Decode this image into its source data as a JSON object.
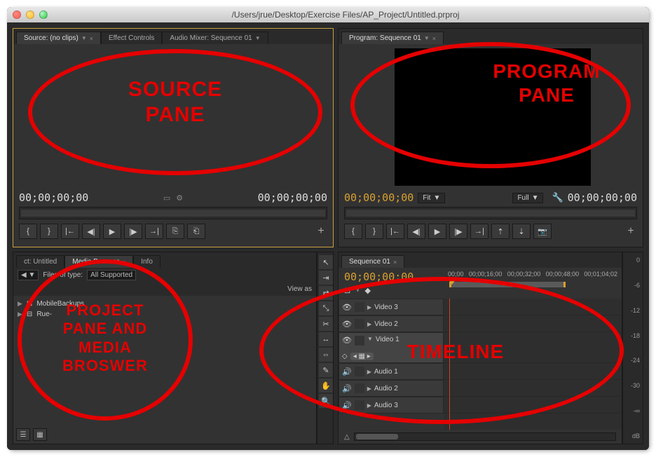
{
  "window": {
    "title": "/Users/jrue/Desktop/Exercise Files/AP_Project/Untitled.prproj"
  },
  "source": {
    "tab_label": "Source: (no clips)",
    "tab_effect": "Effect Controls",
    "tab_audio": "Audio Mixer: Sequence 01",
    "tc_left": "00;00;00;00",
    "tc_right": "00;00;00;00"
  },
  "program": {
    "tab_label": "Program: Sequence 01",
    "tc_left": "00;00;00;00",
    "tc_right": "00;00;00;00",
    "fit_label": "Fit",
    "full_label": "Full"
  },
  "project": {
    "tab_project": "ct: Untitled",
    "tab_media": "Media Browser",
    "tab_info": "Info",
    "files_of_type_label": "Files of type:",
    "files_of_type_value": "All Supported",
    "view_as": "View as",
    "items": [
      "MobileBackups",
      "Rue-"
    ]
  },
  "timeline": {
    "tab_label": "Sequence 01",
    "tc": "00;00;00;00",
    "ruler": [
      "00;00",
      "00;00;16;00",
      "00;00;32;00",
      "00;00;48;00",
      "00;01;04;02"
    ],
    "tracks": {
      "v3": "Video 3",
      "v2": "Video 2",
      "v1": "Video 1",
      "a1": "Audio 1",
      "a2": "Audio 2",
      "a3": "Audio 3"
    }
  },
  "meter": {
    "unit": "dB",
    "ticks": [
      "0",
      "-6",
      "-12",
      "-18",
      "-24",
      "-30",
      "-∞"
    ]
  },
  "annotations": {
    "source": "SOURCE PANE",
    "program": "PROGRAM PANE",
    "project": "PROJECT PANE AND MEDIA BROSWER",
    "timeline": "TIMELINE"
  },
  "icons": {
    "dropdown": "▼",
    "close": "×",
    "plus": "+",
    "wrench": "🔧",
    "mark_in": "{",
    "mark_out": "}",
    "goto_in": "|←",
    "step_back": "◀|",
    "play": "▶",
    "step_fwd": "|▶",
    "goto_out": "→|",
    "insert": "⎘",
    "overwrite": "⎗",
    "lift": "⇡",
    "extract": "⇣",
    "export": "📷",
    "arrow": "↖",
    "track_select": "⇥",
    "ripple": "⇄",
    "razor": "✂",
    "slip": "↔",
    "pen": "✎",
    "hand": "✋",
    "zoom": "🔍",
    "eye": "👁",
    "speaker": "🔊",
    "tri_right": "▶",
    "tri_down": "▼",
    "list": "☰",
    "grid": "▦"
  }
}
